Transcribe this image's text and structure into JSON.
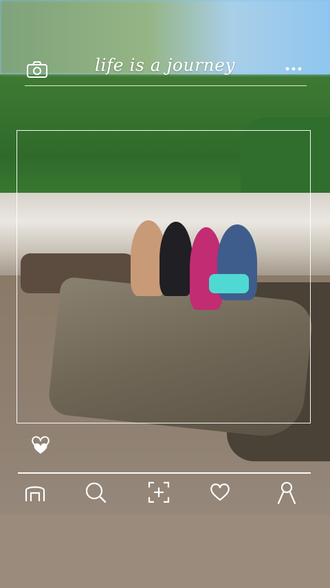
{
  "header": {
    "title": "life is a journey",
    "camera_icon": "camera-icon",
    "more_icon": "more-dots-icon"
  },
  "post": {
    "like_icon": "heart-icon",
    "like_color": "#ffffff"
  },
  "nav": {
    "items": [
      {
        "icon": "home-icon"
      },
      {
        "icon": "search-icon"
      },
      {
        "icon": "add-post-icon"
      },
      {
        "icon": "heart-icon"
      },
      {
        "icon": "profile-icon"
      }
    ]
  },
  "colors": {
    "overlay": "#ffffff",
    "sky": "#8fc6ef",
    "foliage": "#2f6a2a",
    "water": "#8e7f70"
  }
}
